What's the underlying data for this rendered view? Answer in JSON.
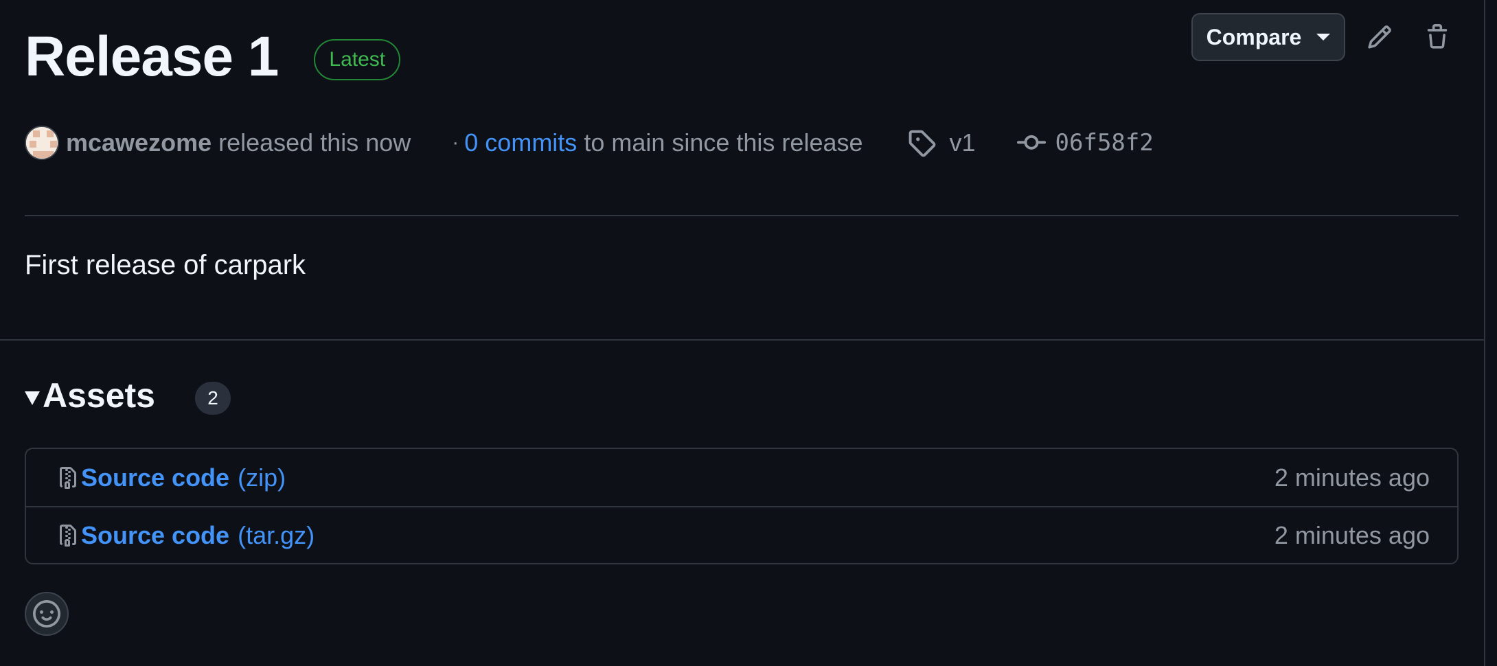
{
  "release": {
    "title": "Release 1",
    "badge": "Latest",
    "author": "mcawezome",
    "released_text": "released this now",
    "separator": "·",
    "commits_link": "0 commits",
    "commits_suffix": "to main since this release",
    "tag": "v1",
    "commit_sha": "06f58f2",
    "description": "First release of carpark"
  },
  "toolbar": {
    "compare_label": "Compare",
    "edit_icon": "pencil-icon",
    "delete_icon": "trash-icon"
  },
  "assets": {
    "title": "Assets",
    "count": "2",
    "items": [
      {
        "name": "Source code",
        "ext": "(zip)",
        "time": "2 minutes ago",
        "icon": "file-zip-icon"
      },
      {
        "name": "Source code",
        "ext": "(tar.gz)",
        "time": "2 minutes ago",
        "icon": "file-zip-icon"
      }
    ]
  },
  "reactions": {
    "icon": "smiley-icon"
  },
  "colors": {
    "background": "#0d1117",
    "border": "#30363d",
    "link": "#4493f8",
    "muted": "#9198a1",
    "success": "#3fb950",
    "success_border": "#238636"
  }
}
